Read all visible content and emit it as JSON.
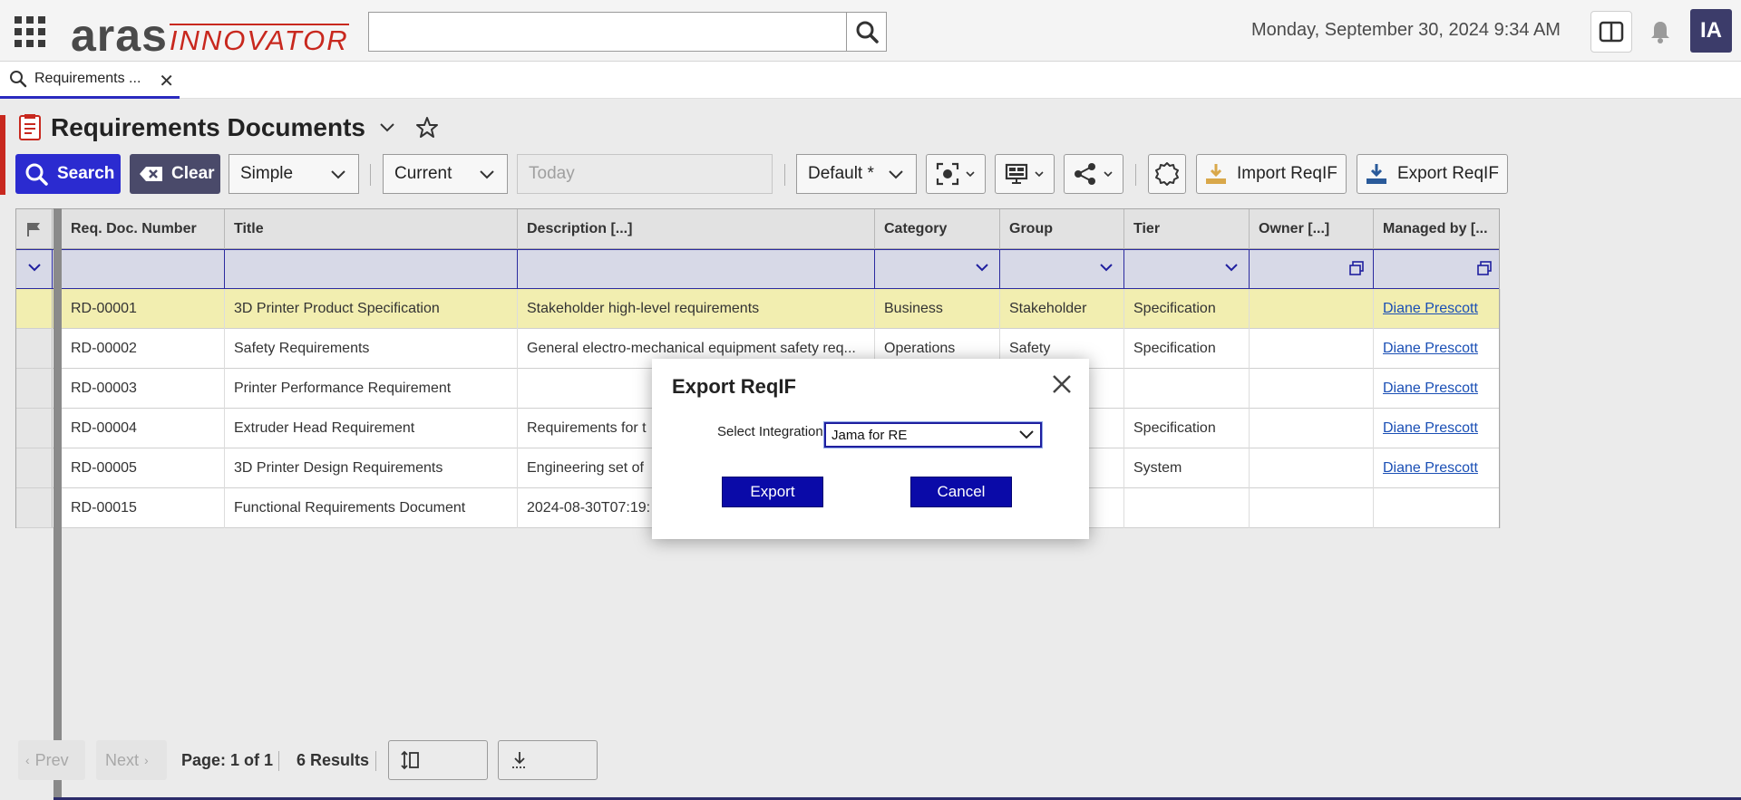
{
  "header": {
    "logo_main": "aras",
    "logo_sub": "INNOVATOR",
    "datetime": "Monday, September 30, 2024 9:34 AM",
    "avatar_initials": "IA"
  },
  "tabs": [
    {
      "label": "Requirements ..."
    }
  ],
  "page": {
    "title": "Requirements Documents"
  },
  "toolbar": {
    "search_label": "Search",
    "clear_label": "Clear",
    "mode_value": "Simple",
    "version_value": "Current",
    "date_placeholder": "Today",
    "view_value": "Default *",
    "import_label": "Import ReqIF",
    "export_label": "Export ReqIF"
  },
  "grid": {
    "columns": [
      "Req. Doc. Number",
      "Title",
      "Description [...]",
      "Category",
      "Group",
      "Tier",
      "Owner [...]",
      "Managed by [..."
    ],
    "rows": [
      {
        "num": "RD-00001",
        "title": "3D Printer Product Specification",
        "desc": "Stakeholder high-level requirements",
        "category": "Business",
        "group": "Stakeholder",
        "tier": "Specification",
        "owner": "",
        "managed": "Diane Prescott"
      },
      {
        "num": "RD-00002",
        "title": "Safety Requirements",
        "desc": "General electro-mechanical equipment safety req...",
        "category": "Operations",
        "group": "Safety",
        "tier": "Specification",
        "owner": "",
        "managed": "Diane Prescott"
      },
      {
        "num": "RD-00003",
        "title": "Printer Performance Requirement",
        "desc": "",
        "category": "",
        "group": "",
        "tier": "",
        "owner": "",
        "managed": "Diane Prescott"
      },
      {
        "num": "RD-00004",
        "title": "Extruder Head Requirement",
        "desc": "Requirements for t",
        "category": "",
        "group": "",
        "tier": "Specification",
        "owner": "",
        "managed": "Diane Prescott"
      },
      {
        "num": "RD-00005",
        "title": "3D Printer Design Requirements",
        "desc": "Engineering set of",
        "category": "",
        "group": "",
        "tier": "System",
        "owner": "",
        "managed": "Diane Prescott"
      },
      {
        "num": "RD-00015",
        "title": "Functional Requirements Document",
        "desc": "2024-08-30T07:19:",
        "category": "",
        "group": "",
        "tier": "",
        "owner": "",
        "managed": ""
      }
    ]
  },
  "pager": {
    "prev_label": "Prev",
    "next_label": "Next",
    "page_label": "Page: 1 of 1",
    "results_label": "6 Results"
  },
  "modal": {
    "title": "Export ReqIF",
    "select_label": "Select Integration",
    "select_value": "Jama for RE",
    "export_button": "Export",
    "cancel_button": "Cancel"
  },
  "colors": {
    "brand_red": "#c8281e",
    "primary_blue": "#2b2bd0",
    "modal_button": "#0a0aa8",
    "selected_row": "#f2eeb0",
    "link": "#1a4fb5"
  }
}
